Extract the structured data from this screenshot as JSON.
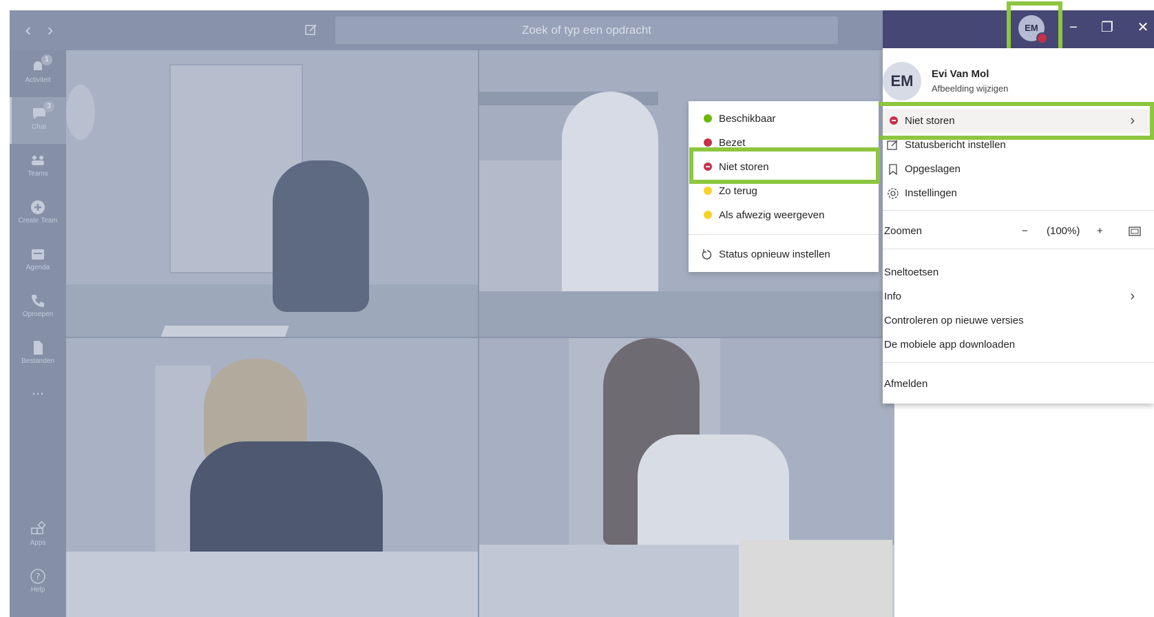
{
  "titlebar": {
    "back_icon": "chevron-left-icon",
    "forward_icon": "chevron-right-icon",
    "compose_icon": "compose-icon",
    "search_placeholder": "Zoek of typ een opdracht"
  },
  "rail": {
    "items": [
      {
        "label": "Activiteit",
        "icon": "bell-icon",
        "badge": "1"
      },
      {
        "label": "Chat",
        "icon": "chat-icon",
        "badge": "3"
      },
      {
        "label": "Teams",
        "icon": "teams-icon"
      },
      {
        "label": "Create Team",
        "icon": "plus-circle-icon"
      },
      {
        "label": "Agenda",
        "icon": "calendar-icon"
      },
      {
        "label": "Oproepen",
        "icon": "phone-icon"
      },
      {
        "label": "Bestanden",
        "icon": "file-icon"
      },
      {
        "label": "...",
        "icon": "more-icon"
      },
      {
        "label": "Apps",
        "icon": "apps-icon"
      },
      {
        "label": "Help",
        "icon": "help-icon"
      }
    ]
  },
  "header": {
    "avatar_initials": "EM",
    "minimize": "−",
    "restore": "❐",
    "close": "✕"
  },
  "profile": {
    "initials": "EM",
    "name": "Evi Van Mol",
    "change_picture": "Afbeelding wijzigen"
  },
  "menu": {
    "status_label": "Niet storen",
    "status_message": "Statusbericht instellen",
    "saved": "Opgeslagen",
    "settings": "Instellingen",
    "zoom_label": "Zoomen",
    "zoom_minus": "−",
    "zoom_value": "(100%)",
    "zoom_plus": "+",
    "shortcuts": "Sneltoetsen",
    "info": "Info",
    "check_updates": "Controleren op nieuwe versies",
    "download_mobile": "De mobiele app downloaden",
    "sign_out": "Afmelden"
  },
  "status_submenu": {
    "items": [
      {
        "label": "Beschikbaar",
        "color": "#6bb700"
      },
      {
        "label": "Bezet",
        "color": "#c4314b"
      },
      {
        "label": "Niet storen",
        "color": "#c4314b"
      },
      {
        "label": "Zo terug",
        "color": "#f8d22a"
      },
      {
        "label": "Als afwezig weergeven",
        "color": "#f8d22a"
      }
    ],
    "reset": "Status opnieuw instellen"
  },
  "colors": {
    "highlight": "#8dc63f",
    "header": "#464775"
  }
}
